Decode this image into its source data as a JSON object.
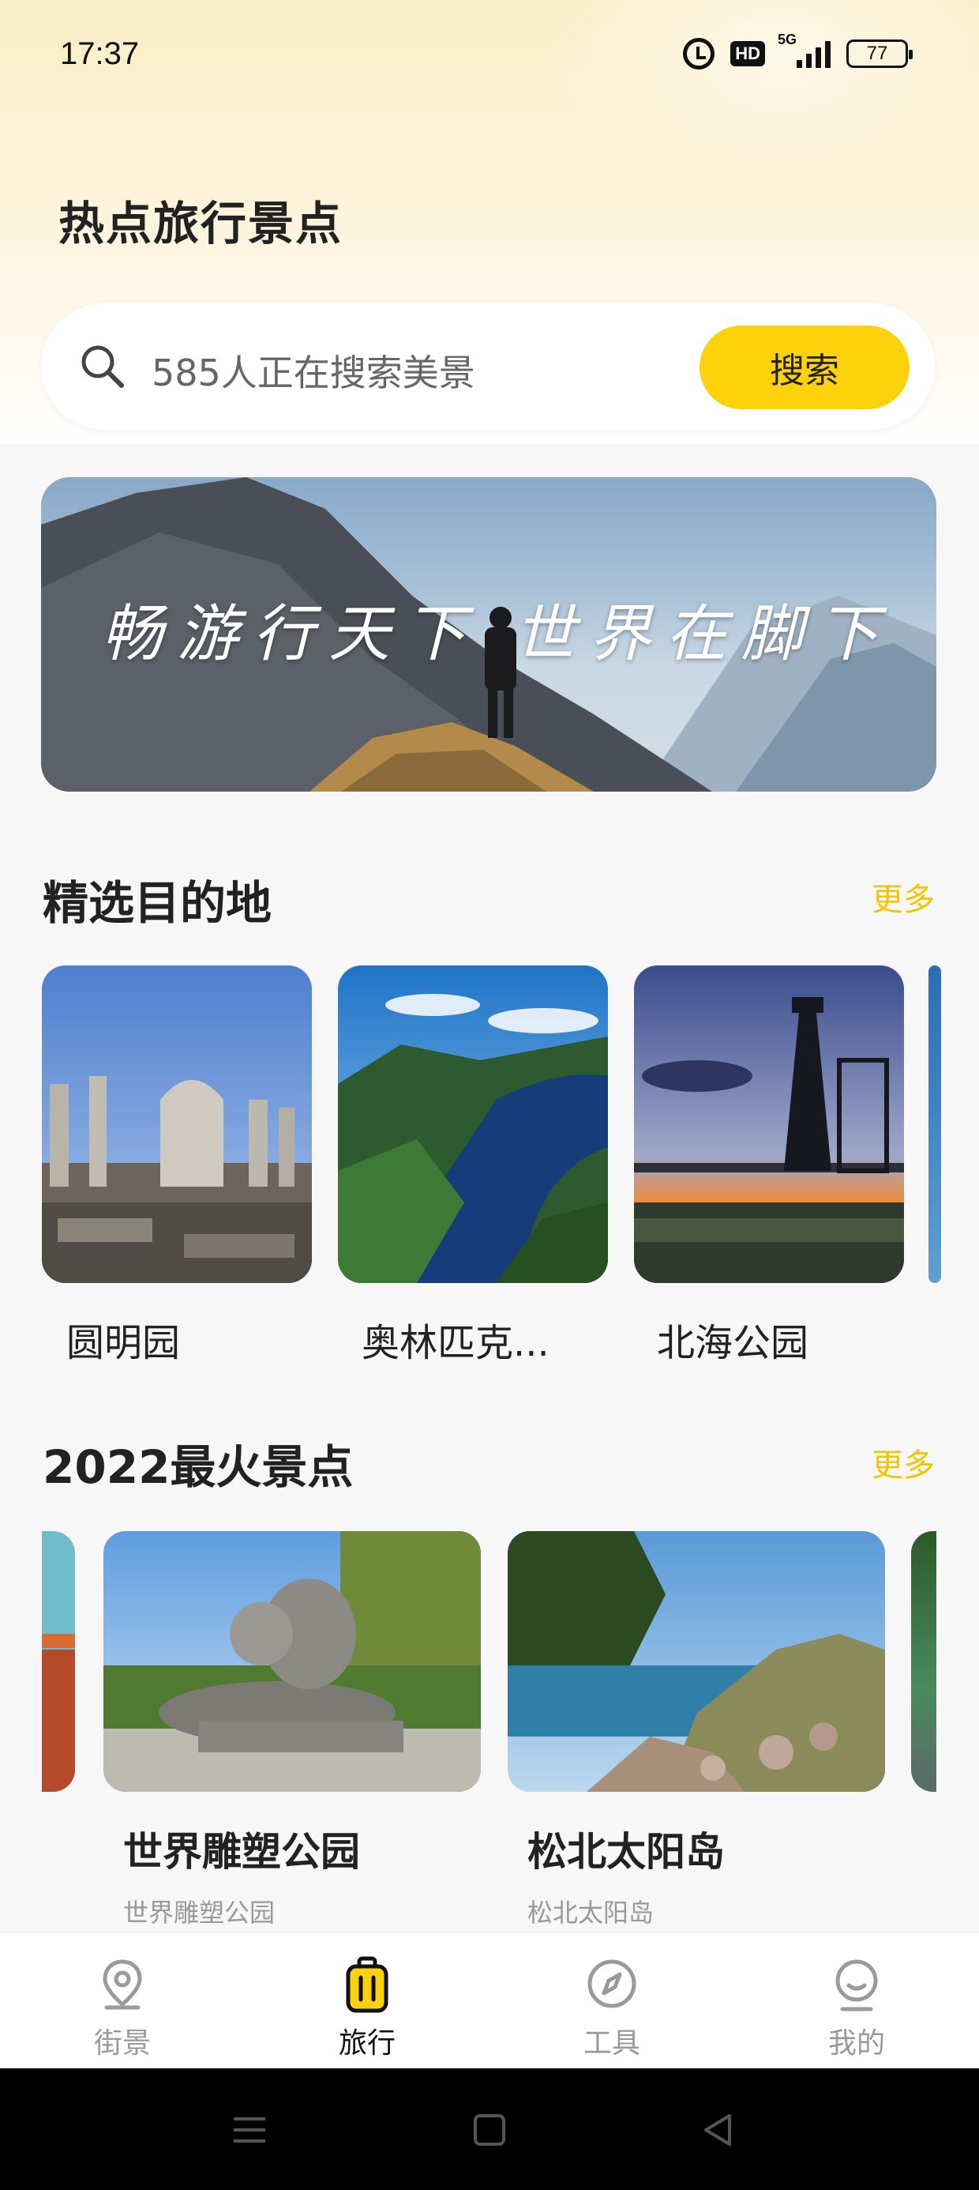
{
  "status_bar": {
    "time": "17:37",
    "icons": [
      "alarm-icon",
      "hd-icon",
      "5g-signal-icon",
      "battery-icon"
    ],
    "hd_label": "HD",
    "network_label": "5G",
    "battery_level": "77"
  },
  "header": {
    "title": "热点旅行景点"
  },
  "search": {
    "placeholder": "585人正在搜索美景",
    "button_label": "搜索",
    "icon": "search-icon"
  },
  "banner": {
    "caption": "畅游行天下  世界在脚下"
  },
  "featured": {
    "title": "精选目的地",
    "more_label": "更多",
    "items": [
      {
        "name": "圆明园"
      },
      {
        "name": "奥林匹克..."
      },
      {
        "name": "北海公园"
      }
    ]
  },
  "popular": {
    "title": "2022最火景点",
    "more_label": "更多",
    "items": [
      {
        "name": "世界雕塑公园",
        "subtitle": "世界雕塑公园"
      },
      {
        "name": "松北太阳岛",
        "subtitle": "松北太阳岛"
      }
    ]
  },
  "tab_bar": {
    "tabs": [
      {
        "label": "街景",
        "icon": "location-pin-icon",
        "active": false
      },
      {
        "label": "旅行",
        "icon": "suitcase-icon",
        "active": true
      },
      {
        "label": "工具",
        "icon": "compass-icon",
        "active": false
      },
      {
        "label": "我的",
        "icon": "profile-icon",
        "active": false
      }
    ]
  },
  "colors": {
    "accent": "#fdd20a",
    "more_link": "#f4c400",
    "background": "#f7f7f7"
  }
}
